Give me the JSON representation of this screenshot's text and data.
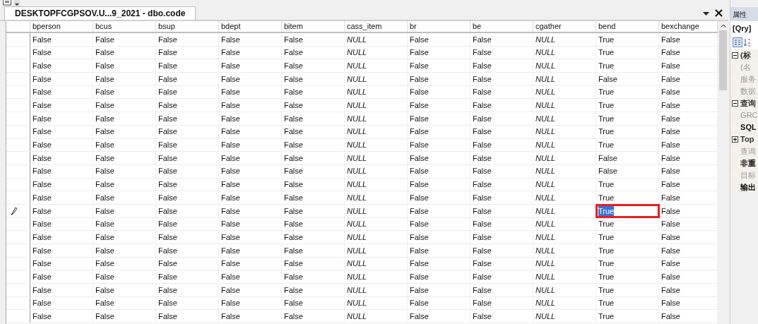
{
  "document_tab": {
    "title": "DESKTOPFCGPSOV.U...9_2021 - dbo.code",
    "selected": true
  },
  "table": {
    "columns": [
      {
        "label": "bperson",
        "kind": "value"
      },
      {
        "label": "bcus",
        "kind": "value"
      },
      {
        "label": "bsup",
        "kind": "value"
      },
      {
        "label": "bdept",
        "kind": "value"
      },
      {
        "label": "bitem",
        "kind": "value"
      },
      {
        "label": "cass_item",
        "kind": "null"
      },
      {
        "label": "br",
        "kind": "value"
      },
      {
        "label": "be",
        "kind": "value"
      },
      {
        "label": "cgather",
        "kind": "null"
      },
      {
        "label": "bend",
        "kind": "value"
      },
      {
        "label": "bexchange",
        "kind": "value"
      }
    ],
    "annotation_box": true,
    "rows": [
      {
        "editing": false,
        "cells": [
          {
            "text": "False",
            "selected": false
          },
          {
            "text": "False",
            "selected": false
          },
          {
            "text": "False",
            "selected": false
          },
          {
            "text": "False",
            "selected": false
          },
          {
            "text": "False",
            "selected": false
          },
          {
            "text": "NULL",
            "selected": false
          },
          {
            "text": "False",
            "selected": false
          },
          {
            "text": "False",
            "selected": false
          },
          {
            "text": "NULL",
            "selected": false
          },
          {
            "text": "True",
            "selected": false
          },
          {
            "text": "False",
            "selected": false
          }
        ]
      },
      {
        "editing": false,
        "cells": [
          {
            "text": "False",
            "selected": false
          },
          {
            "text": "False",
            "selected": false
          },
          {
            "text": "False",
            "selected": false
          },
          {
            "text": "False",
            "selected": false
          },
          {
            "text": "False",
            "selected": false
          },
          {
            "text": "NULL",
            "selected": false
          },
          {
            "text": "False",
            "selected": false
          },
          {
            "text": "False",
            "selected": false
          },
          {
            "text": "NULL",
            "selected": false
          },
          {
            "text": "True",
            "selected": false
          },
          {
            "text": "False",
            "selected": false
          }
        ]
      },
      {
        "editing": false,
        "cells": [
          {
            "text": "False",
            "selected": false
          },
          {
            "text": "False",
            "selected": false
          },
          {
            "text": "False",
            "selected": false
          },
          {
            "text": "False",
            "selected": false
          },
          {
            "text": "False",
            "selected": false
          },
          {
            "text": "NULL",
            "selected": false
          },
          {
            "text": "False",
            "selected": false
          },
          {
            "text": "False",
            "selected": false
          },
          {
            "text": "NULL",
            "selected": false
          },
          {
            "text": "True",
            "selected": false
          },
          {
            "text": "False",
            "selected": false
          }
        ]
      },
      {
        "editing": false,
        "cells": [
          {
            "text": "False",
            "selected": false
          },
          {
            "text": "False",
            "selected": false
          },
          {
            "text": "False",
            "selected": false
          },
          {
            "text": "False",
            "selected": false
          },
          {
            "text": "False",
            "selected": false
          },
          {
            "text": "NULL",
            "selected": false
          },
          {
            "text": "False",
            "selected": false
          },
          {
            "text": "False",
            "selected": false
          },
          {
            "text": "NULL",
            "selected": false
          },
          {
            "text": "False",
            "selected": false
          },
          {
            "text": "False",
            "selected": false
          }
        ]
      },
      {
        "editing": false,
        "cells": [
          {
            "text": "False",
            "selected": false
          },
          {
            "text": "False",
            "selected": false
          },
          {
            "text": "False",
            "selected": false
          },
          {
            "text": "False",
            "selected": false
          },
          {
            "text": "False",
            "selected": false
          },
          {
            "text": "NULL",
            "selected": false
          },
          {
            "text": "False",
            "selected": false
          },
          {
            "text": "False",
            "selected": false
          },
          {
            "text": "NULL",
            "selected": false
          },
          {
            "text": "True",
            "selected": false
          },
          {
            "text": "False",
            "selected": false
          }
        ]
      },
      {
        "editing": false,
        "cells": [
          {
            "text": "False",
            "selected": false
          },
          {
            "text": "False",
            "selected": false
          },
          {
            "text": "False",
            "selected": false
          },
          {
            "text": "False",
            "selected": false
          },
          {
            "text": "False",
            "selected": false
          },
          {
            "text": "NULL",
            "selected": false
          },
          {
            "text": "False",
            "selected": false
          },
          {
            "text": "False",
            "selected": false
          },
          {
            "text": "NULL",
            "selected": false
          },
          {
            "text": "True",
            "selected": false
          },
          {
            "text": "False",
            "selected": false
          }
        ]
      },
      {
        "editing": false,
        "cells": [
          {
            "text": "False",
            "selected": false
          },
          {
            "text": "False",
            "selected": false
          },
          {
            "text": "False",
            "selected": false
          },
          {
            "text": "False",
            "selected": false
          },
          {
            "text": "False",
            "selected": false
          },
          {
            "text": "NULL",
            "selected": false
          },
          {
            "text": "False",
            "selected": false
          },
          {
            "text": "False",
            "selected": false
          },
          {
            "text": "NULL",
            "selected": false
          },
          {
            "text": "True",
            "selected": false
          },
          {
            "text": "False",
            "selected": false
          }
        ]
      },
      {
        "editing": false,
        "cells": [
          {
            "text": "False",
            "selected": false
          },
          {
            "text": "False",
            "selected": false
          },
          {
            "text": "False",
            "selected": false
          },
          {
            "text": "False",
            "selected": false
          },
          {
            "text": "False",
            "selected": false
          },
          {
            "text": "NULL",
            "selected": false
          },
          {
            "text": "False",
            "selected": false
          },
          {
            "text": "False",
            "selected": false
          },
          {
            "text": "NULL",
            "selected": false
          },
          {
            "text": "True",
            "selected": false
          },
          {
            "text": "False",
            "selected": false
          }
        ]
      },
      {
        "editing": false,
        "cells": [
          {
            "text": "False",
            "selected": false
          },
          {
            "text": "False",
            "selected": false
          },
          {
            "text": "False",
            "selected": false
          },
          {
            "text": "False",
            "selected": false
          },
          {
            "text": "False",
            "selected": false
          },
          {
            "text": "NULL",
            "selected": false
          },
          {
            "text": "False",
            "selected": false
          },
          {
            "text": "False",
            "selected": false
          },
          {
            "text": "NULL",
            "selected": false
          },
          {
            "text": "True",
            "selected": false
          },
          {
            "text": "False",
            "selected": false
          }
        ]
      },
      {
        "editing": false,
        "cells": [
          {
            "text": "False",
            "selected": false
          },
          {
            "text": "False",
            "selected": false
          },
          {
            "text": "False",
            "selected": false
          },
          {
            "text": "False",
            "selected": false
          },
          {
            "text": "False",
            "selected": false
          },
          {
            "text": "NULL",
            "selected": false
          },
          {
            "text": "False",
            "selected": false
          },
          {
            "text": "False",
            "selected": false
          },
          {
            "text": "NULL",
            "selected": false
          },
          {
            "text": "False",
            "selected": false
          },
          {
            "text": "False",
            "selected": false
          }
        ]
      },
      {
        "editing": false,
        "cells": [
          {
            "text": "False",
            "selected": false
          },
          {
            "text": "False",
            "selected": false
          },
          {
            "text": "False",
            "selected": false
          },
          {
            "text": "False",
            "selected": false
          },
          {
            "text": "False",
            "selected": false
          },
          {
            "text": "NULL",
            "selected": false
          },
          {
            "text": "False",
            "selected": false
          },
          {
            "text": "False",
            "selected": false
          },
          {
            "text": "NULL",
            "selected": false
          },
          {
            "text": "False",
            "selected": false
          },
          {
            "text": "False",
            "selected": false
          }
        ]
      },
      {
        "editing": false,
        "cells": [
          {
            "text": "False",
            "selected": false
          },
          {
            "text": "False",
            "selected": false
          },
          {
            "text": "False",
            "selected": false
          },
          {
            "text": "False",
            "selected": false
          },
          {
            "text": "False",
            "selected": false
          },
          {
            "text": "NULL",
            "selected": false
          },
          {
            "text": "False",
            "selected": false
          },
          {
            "text": "False",
            "selected": false
          },
          {
            "text": "NULL",
            "selected": false
          },
          {
            "text": "True",
            "selected": false
          },
          {
            "text": "False",
            "selected": false
          }
        ]
      },
      {
        "editing": false,
        "cells": [
          {
            "text": "False",
            "selected": false
          },
          {
            "text": "False",
            "selected": false
          },
          {
            "text": "False",
            "selected": false
          },
          {
            "text": "False",
            "selected": false
          },
          {
            "text": "False",
            "selected": false
          },
          {
            "text": "NULL",
            "selected": false
          },
          {
            "text": "False",
            "selected": false
          },
          {
            "text": "False",
            "selected": false
          },
          {
            "text": "NULL",
            "selected": false
          },
          {
            "text": "True",
            "selected": false
          },
          {
            "text": "False",
            "selected": false
          }
        ]
      },
      {
        "editing": true,
        "cells": [
          {
            "text": "False",
            "selected": false
          },
          {
            "text": "False",
            "selected": false
          },
          {
            "text": "False",
            "selected": false
          },
          {
            "text": "False",
            "selected": false
          },
          {
            "text": "False",
            "selected": false
          },
          {
            "text": "NULL",
            "selected": false
          },
          {
            "text": "False",
            "selected": false
          },
          {
            "text": "False",
            "selected": false
          },
          {
            "text": "NULL",
            "selected": false
          },
          {
            "text": "True",
            "selected": true
          },
          {
            "text": "False",
            "selected": false
          }
        ]
      },
      {
        "editing": false,
        "cells": [
          {
            "text": "False",
            "selected": false
          },
          {
            "text": "False",
            "selected": false
          },
          {
            "text": "False",
            "selected": false
          },
          {
            "text": "False",
            "selected": false
          },
          {
            "text": "False",
            "selected": false
          },
          {
            "text": "NULL",
            "selected": false
          },
          {
            "text": "False",
            "selected": false
          },
          {
            "text": "False",
            "selected": false
          },
          {
            "text": "NULL",
            "selected": false
          },
          {
            "text": "True",
            "selected": false
          },
          {
            "text": "False",
            "selected": false
          }
        ]
      },
      {
        "editing": false,
        "cells": [
          {
            "text": "False",
            "selected": false
          },
          {
            "text": "False",
            "selected": false
          },
          {
            "text": "False",
            "selected": false
          },
          {
            "text": "False",
            "selected": false
          },
          {
            "text": "False",
            "selected": false
          },
          {
            "text": "NULL",
            "selected": false
          },
          {
            "text": "False",
            "selected": false
          },
          {
            "text": "False",
            "selected": false
          },
          {
            "text": "NULL",
            "selected": false
          },
          {
            "text": "True",
            "selected": false
          },
          {
            "text": "False",
            "selected": false
          }
        ]
      },
      {
        "editing": false,
        "cells": [
          {
            "text": "False",
            "selected": false
          },
          {
            "text": "False",
            "selected": false
          },
          {
            "text": "False",
            "selected": false
          },
          {
            "text": "False",
            "selected": false
          },
          {
            "text": "False",
            "selected": false
          },
          {
            "text": "NULL",
            "selected": false
          },
          {
            "text": "False",
            "selected": false
          },
          {
            "text": "False",
            "selected": false
          },
          {
            "text": "NULL",
            "selected": false
          },
          {
            "text": "True",
            "selected": false
          },
          {
            "text": "False",
            "selected": false
          }
        ]
      },
      {
        "editing": false,
        "cells": [
          {
            "text": "False",
            "selected": false
          },
          {
            "text": "False",
            "selected": false
          },
          {
            "text": "False",
            "selected": false
          },
          {
            "text": "False",
            "selected": false
          },
          {
            "text": "False",
            "selected": false
          },
          {
            "text": "NULL",
            "selected": false
          },
          {
            "text": "False",
            "selected": false
          },
          {
            "text": "False",
            "selected": false
          },
          {
            "text": "NULL",
            "selected": false
          },
          {
            "text": "True",
            "selected": false
          },
          {
            "text": "False",
            "selected": false
          }
        ]
      },
      {
        "editing": false,
        "cells": [
          {
            "text": "False",
            "selected": false
          },
          {
            "text": "False",
            "selected": false
          },
          {
            "text": "False",
            "selected": false
          },
          {
            "text": "False",
            "selected": false
          },
          {
            "text": "False",
            "selected": false
          },
          {
            "text": "NULL",
            "selected": false
          },
          {
            "text": "False",
            "selected": false
          },
          {
            "text": "False",
            "selected": false
          },
          {
            "text": "NULL",
            "selected": false
          },
          {
            "text": "True",
            "selected": false
          },
          {
            "text": "False",
            "selected": false
          }
        ]
      },
      {
        "editing": false,
        "cells": [
          {
            "text": "False",
            "selected": false
          },
          {
            "text": "False",
            "selected": false
          },
          {
            "text": "False",
            "selected": false
          },
          {
            "text": "False",
            "selected": false
          },
          {
            "text": "False",
            "selected": false
          },
          {
            "text": "NULL",
            "selected": false
          },
          {
            "text": "False",
            "selected": false
          },
          {
            "text": "False",
            "selected": false
          },
          {
            "text": "NULL",
            "selected": false
          },
          {
            "text": "True",
            "selected": false
          },
          {
            "text": "False",
            "selected": false
          }
        ]
      },
      {
        "editing": false,
        "cells": [
          {
            "text": "False",
            "selected": false
          },
          {
            "text": "False",
            "selected": false
          },
          {
            "text": "False",
            "selected": false
          },
          {
            "text": "False",
            "selected": false
          },
          {
            "text": "False",
            "selected": false
          },
          {
            "text": "NULL",
            "selected": false
          },
          {
            "text": "False",
            "selected": false
          },
          {
            "text": "False",
            "selected": false
          },
          {
            "text": "NULL",
            "selected": false
          },
          {
            "text": "True",
            "selected": false
          },
          {
            "text": "False",
            "selected": false
          }
        ]
      },
      {
        "editing": false,
        "cells": [
          {
            "text": "False",
            "selected": false
          },
          {
            "text": "False",
            "selected": false
          },
          {
            "text": "False",
            "selected": false
          },
          {
            "text": "False",
            "selected": false
          },
          {
            "text": "False",
            "selected": false
          },
          {
            "text": "NULL",
            "selected": false
          },
          {
            "text": "False",
            "selected": false
          },
          {
            "text": "False",
            "selected": false
          },
          {
            "text": "NULL",
            "selected": false
          },
          {
            "text": "True",
            "selected": false
          },
          {
            "text": "False",
            "selected": false
          }
        ]
      }
    ]
  },
  "properties": {
    "title": "属性",
    "object": "[Qry]",
    "items": [
      {
        "kind": "group",
        "label": "(标",
        "expanded": true
      },
      {
        "kind": "property",
        "label": "(名",
        "bold": false
      },
      {
        "kind": "property",
        "label": "服务",
        "bold": false
      },
      {
        "kind": "property",
        "label": "数据",
        "bold": false
      },
      {
        "kind": "group",
        "label": "查询",
        "expanded": true
      },
      {
        "kind": "property",
        "label": "GRC",
        "bold": false
      },
      {
        "kind": "property",
        "label": "SQL",
        "bold": true
      },
      {
        "kind": "group",
        "label": "Top",
        "expanded": false
      },
      {
        "kind": "property",
        "label": "查询",
        "bold": false
      },
      {
        "kind": "property",
        "label": "非重",
        "bold": true
      },
      {
        "kind": "property",
        "label": "目标",
        "bold": false
      },
      {
        "kind": "property",
        "label": "输出",
        "bold": true
      }
    ]
  }
}
